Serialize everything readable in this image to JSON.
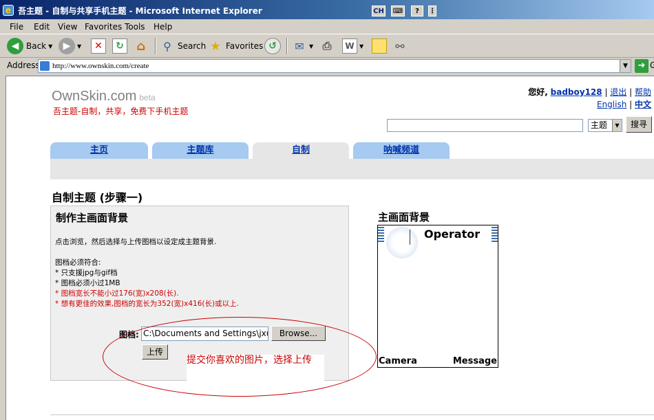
{
  "window": {
    "title": "吾主题 - 自制与共享手机主题 - Microsoft Internet Explorer",
    "lang_indicator": "CH"
  },
  "menu": [
    "File",
    "Edit",
    "View",
    "Favorites",
    "Tools",
    "Help"
  ],
  "toolbar": {
    "back": "Back",
    "search": "Search",
    "favorites": "Favorites"
  },
  "address": {
    "label": "Address",
    "url": "http://www.ownskin.com/create",
    "go": "G"
  },
  "site": {
    "logo": "OwnSkin.com",
    "beta": "beta",
    "tagline": "吾主题-自制，共享，免费下手机主题"
  },
  "user": {
    "greeting": "您好,",
    "username": "badboy128",
    "logout": "退出",
    "help": "帮助",
    "english": "English",
    "chinese": "中文"
  },
  "search": {
    "category": "主题",
    "button": "搜寻"
  },
  "tabs": [
    "主页",
    "主题库",
    "自制",
    "呐喊频道"
  ],
  "active_tab": 2,
  "page": {
    "heading": "自制主题 (步骤一)",
    "panel_title": "制作主画面背景",
    "instruction": "点击浏览，然后选择与上传图档以设定成主题背景.",
    "requirements_title": "图档必须符合:",
    "req1": "* 只支援jpg与gif档",
    "req2": "* 图档必须小过1MB",
    "req3": "* 图档宽长不能小过176(宽)x208(长).",
    "req4": "* 想有更佳的效果,图档的宽长为352(宽)x416(长)或以上.",
    "file_label": "图档:",
    "file_value": "C:\\Documents and Settings\\jxu",
    "browse": "Browse...",
    "upload": "上传",
    "annotation": "提交你喜欢的图片，选择上传"
  },
  "preview": {
    "title": "主画面背景",
    "operator": "Operator",
    "soft_left": "Camera",
    "soft_right": "Message"
  }
}
